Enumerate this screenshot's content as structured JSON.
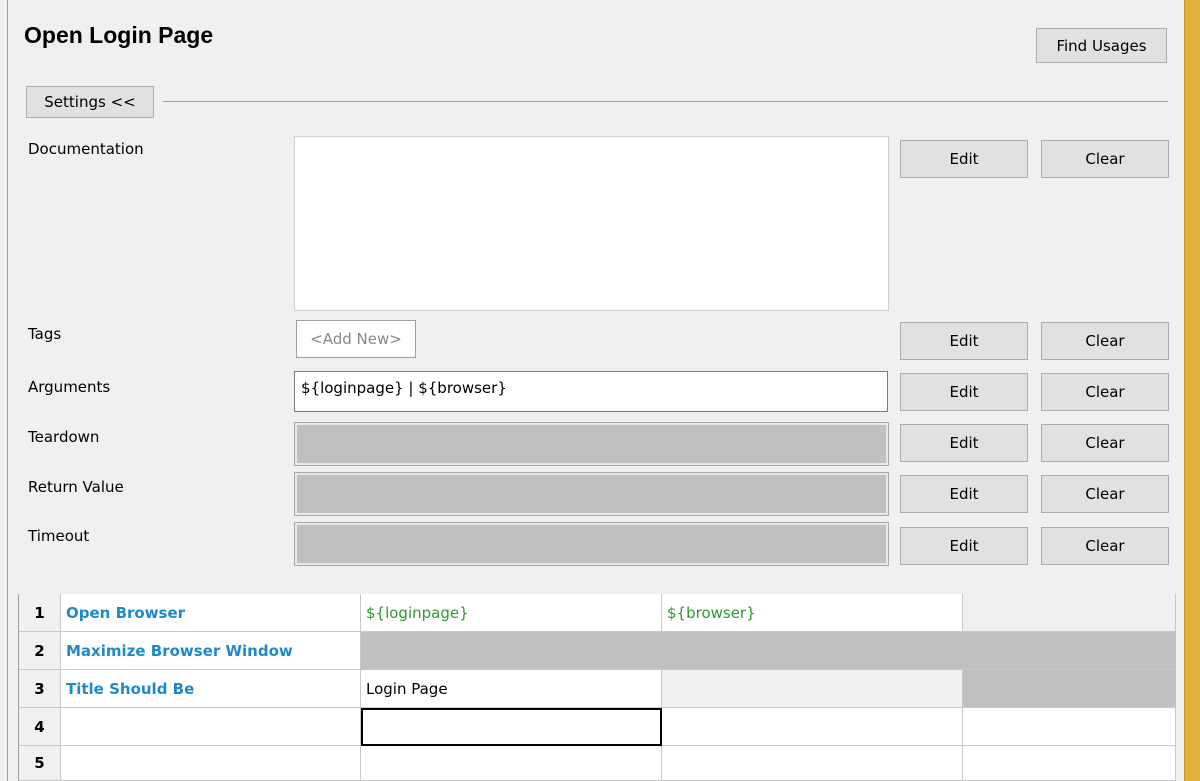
{
  "header": {
    "title": "Open Login Page",
    "find_usages_label": "Find Usages",
    "settings_label": "Settings <<"
  },
  "settings": {
    "documentation": {
      "label": "Documentation",
      "value": "",
      "edit": "Edit",
      "clear": "Clear"
    },
    "tags": {
      "label": "Tags",
      "add_new": "<Add New>",
      "edit": "Edit",
      "clear": "Clear"
    },
    "arguments": {
      "label": "Arguments",
      "value": "${loginpage} | ${browser}",
      "edit": "Edit",
      "clear": "Clear"
    },
    "teardown": {
      "label": "Teardown",
      "value": "",
      "edit": "Edit",
      "clear": "Clear"
    },
    "return_value": {
      "label": "Return Value",
      "value": "",
      "edit": "Edit",
      "clear": "Clear"
    },
    "timeout": {
      "label": "Timeout",
      "value": "",
      "edit": "Edit",
      "clear": "Clear"
    }
  },
  "grid": {
    "rows": [
      {
        "num": "1",
        "keyword": "Open Browser",
        "arg1": "${loginpage}",
        "arg2": "${browser}",
        "arg3": ""
      },
      {
        "num": "2",
        "keyword": "Maximize Browser Window",
        "arg1": "",
        "arg2": "",
        "arg3": ""
      },
      {
        "num": "3",
        "keyword": "Title Should Be",
        "arg1": "Login Page",
        "arg2": "",
        "arg3": ""
      },
      {
        "num": "4",
        "keyword": "",
        "arg1": "",
        "arg2": "",
        "arg3": ""
      },
      {
        "num": "5",
        "keyword": "",
        "arg1": "",
        "arg2": "",
        "arg3": ""
      }
    ]
  }
}
